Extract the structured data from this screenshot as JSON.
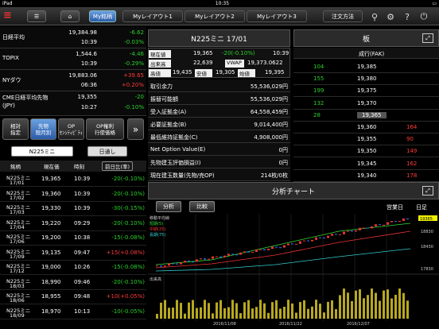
{
  "status": {
    "device": "iPad",
    "time": "10:35"
  },
  "topbar": {
    "menu_label": "",
    "home_label": "",
    "mystock": "My銘柄",
    "tabs": [
      "Myレイアウト1",
      "Myレイアウト2",
      "Myレイアウト3"
    ],
    "order": "注文方法",
    "help": "?"
  },
  "indices": [
    {
      "name": "日経平均",
      "value": "19,384.98",
      "change": "-6.62",
      "time": "10:39",
      "pct": "-0.03%"
    },
    {
      "name": "TOPIX",
      "value": "1,544.6",
      "change": "-4.46",
      "time": "10:39",
      "pct": "-0.29%"
    },
    {
      "name": "NYダウ",
      "value": "19,883.06",
      "change": "+39.65",
      "time": "06:36",
      "pct": "+0.20%"
    },
    {
      "name": "CME日経平均先物",
      "name2": "(JPY)",
      "value": "19,355",
      "change": "-20",
      "time": "10:27",
      "pct": "-0.10%"
    }
  ],
  "segments": [
    [
      "相対",
      "指定"
    ],
    [
      "先物",
      "限月別"
    ],
    [
      "OP",
      "ｾﾝｼﾃｨﾋﾞﾃｨ"
    ],
    [
      "OP権利",
      "行使価格"
    ]
  ],
  "list": {
    "tab": "N225ミニ",
    "tab2": "日通し",
    "headers": [
      "銘柄",
      "現在価",
      "時刻",
      "前日比(率)"
    ],
    "rows": [
      {
        "n1": "N225ミニ",
        "n2": "17/01",
        "p": "19,365",
        "t": "10:39",
        "c": "-20(-0.10%)",
        "cls": "g"
      },
      {
        "n1": "N225ミニ",
        "n2": "17/02",
        "p": "19,360",
        "t": "10:39",
        "c": "-20(-0.10%)",
        "cls": "g"
      },
      {
        "n1": "N225ミニ",
        "n2": "17/03",
        "p": "19,330",
        "t": "10:39",
        "c": "-30(-0.15%)",
        "cls": "g"
      },
      {
        "n1": "N225ミニ",
        "n2": "17/04",
        "p": "19,220",
        "t": "09:29",
        "c": "-20(-0.10%)",
        "cls": "g"
      },
      {
        "n1": "N225ミニ",
        "n2": "17/06",
        "p": "19,200",
        "t": "10:38",
        "c": "-15(-0.08%)",
        "cls": "g"
      },
      {
        "n1": "N225ミニ",
        "n2": "17/09",
        "p": "19,135",
        "t": "09:47",
        "c": "+15(+0.08%)",
        "cls": "r"
      },
      {
        "n1": "N225ミニ",
        "n2": "17/12",
        "p": "19,000",
        "t": "10:26",
        "c": "-15(-0.08%)",
        "cls": "g"
      },
      {
        "n1": "N225ミニ",
        "n2": "18/03",
        "p": "18,990",
        "t": "09:46",
        "c": "-20(-0.10%)",
        "cls": "g"
      },
      {
        "n1": "N225ミニ",
        "n2": "18/06",
        "p": "18,955",
        "t": "09:48",
        "c": "+10(+0.05%)",
        "cls": "r"
      },
      {
        "n1": "N225ミニ",
        "n2": "18/09",
        "p": "18,970",
        "t": "10:13",
        "c": "-10(-0.05%)",
        "cls": "g"
      }
    ]
  },
  "quote": {
    "title": "N225ミニ 17/01",
    "current_label": "現在値",
    "current": "19,365",
    "change": "-20(-0.10%)",
    "time": "10:39",
    "vol_label": "出来高",
    "vol": "22,639",
    "vwap_label": "VWAP",
    "vwap": "19,373.0622",
    "high_label": "高値",
    "high": "19,435",
    "low_label": "安値",
    "low": "19,305",
    "open_label": "始値",
    "open": "19,395"
  },
  "account": [
    {
      "l": "取引余力",
      "v": "55,536,029円"
    },
    {
      "l": "振替可能額",
      "v": "55,536,029円"
    },
    {
      "l": "受入証拠金(A)",
      "v": "64,558,459円"
    },
    {
      "l": "必要証拠金(B)",
      "v": "9,014,400円"
    },
    {
      "l": "最低維持証拠金(C)",
      "v": "4,908,000円"
    },
    {
      "l": "Net Option Value(E)",
      "v": "0円"
    },
    {
      "l": "先物建玉評価損益(I)",
      "v": "0円"
    },
    {
      "l": "現在建玉数量(先物/売OP)",
      "v": "214枚/0枚"
    }
  ],
  "board": {
    "title": "板",
    "mode": "成行(FAK)",
    "rows": [
      {
        "b": "104",
        "p": "19,385",
        "a": ""
      },
      {
        "b": "155",
        "p": "19,380",
        "a": ""
      },
      {
        "b": "199",
        "p": "19,375",
        "a": ""
      },
      {
        "b": "132",
        "p": "19,370",
        "a": ""
      },
      {
        "b": "28",
        "p": "19,365",
        "a": "",
        "hl": true
      },
      {
        "b": "",
        "p": "19,360",
        "a": "164"
      },
      {
        "b": "",
        "p": "19,355",
        "a": "90"
      },
      {
        "b": "",
        "p": "19,350",
        "a": "149"
      },
      {
        "b": "",
        "p": "19,345",
        "a": "162"
      },
      {
        "b": "",
        "p": "19,340",
        "a": "178"
      }
    ]
  },
  "chart": {
    "title": "分析チャート",
    "btn1": "分析",
    "btn2": "比較",
    "mode1": "営業日",
    "mode2": "日足",
    "ma_label": "移動平均線",
    "legend": [
      "短期(5)",
      "中期(25)",
      "長期(75)"
    ],
    "price_tag": "19365",
    "yticks": [
      "18830",
      "18430",
      "17830"
    ],
    "vol_label": "出来高",
    "dates": [
      "2016/11/08",
      "2016/11/22",
      "2016/12/07"
    ]
  }
}
